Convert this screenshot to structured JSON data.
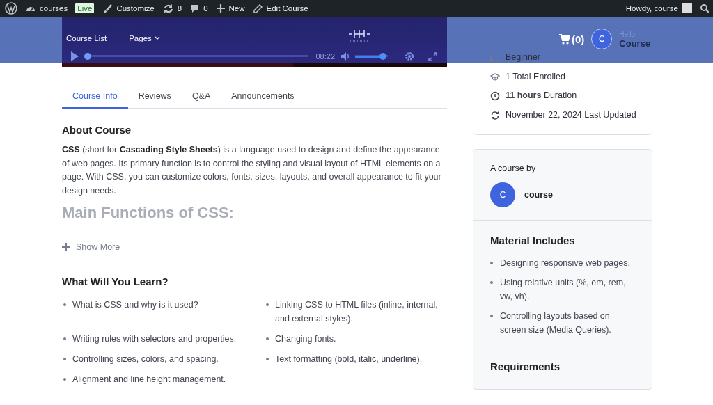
{
  "admin_bar": {
    "items": [
      {
        "kind": "wp-logo"
      },
      {
        "kind": "site",
        "label": "courses",
        "badge": "Live"
      },
      {
        "kind": "customize",
        "label": "Customize"
      },
      {
        "kind": "updates",
        "label": "8"
      },
      {
        "kind": "comments",
        "label": "0"
      },
      {
        "kind": "new",
        "label": "New"
      },
      {
        "kind": "edit",
        "label": "Edit Course"
      }
    ],
    "greeting": "Howdy, course"
  },
  "header": {
    "cart_count": "(0)",
    "avatar_letter": "C",
    "greeting": "Hello",
    "user": "Course"
  },
  "video": {
    "nav": [
      "Course List",
      "Pages"
    ],
    "time": "08:22",
    "progress": {
      "level": 0
    },
    "volume": {
      "level": 0.95
    }
  },
  "tabs": [
    {
      "label": "Course Info",
      "selected": true
    },
    {
      "label": "Reviews",
      "selected": false
    },
    {
      "label": "Q&A",
      "selected": false
    },
    {
      "label": "Announcements",
      "selected": false
    }
  ],
  "about": {
    "title": "About Course",
    "text": "**CSS** (short for **Cascading Style Sheets**) is a language used to design and define the appearance of web pages. Its primary function is to control the styling and visual layout of HTML elements on a page. With CSS, you can customize colors, fonts, sizes, layouts, and overall appearance to fit your design needs.",
    "faded_heading": "Main Functions of CSS:",
    "show_more": "Show More"
  },
  "learn": {
    "title": "What Will You Learn?",
    "items": [
      "What is CSS and why is it used?",
      "Linking CSS to HTML files (inline, internal, and external styles).",
      "Writing rules with selectors and properties.",
      "Changing fonts.",
      "Controlling sizes, colors, and spacing.",
      "Text formatting (bold, italic, underline).",
      "Alignment and line height management."
    ]
  },
  "sidebar": {
    "meta": [
      {
        "kind": "level",
        "text": "Beginner"
      },
      {
        "kind": "enrolled",
        "text": "1 Total Enrolled"
      },
      {
        "kind": "duration",
        "text": "**11 hours**  Duration"
      },
      {
        "kind": "updated",
        "text": "November 22, 2024 Last Updated"
      }
    ],
    "instructor": {
      "heading": "A course by",
      "avatar_letter": "C",
      "name": "course"
    },
    "materials": {
      "title": "Material Includes",
      "items": [
        "Designing responsive web pages.",
        "Using relative units (%, em, rem, vw, vh).",
        "Controlling layouts based on screen size (Media Queries)."
      ]
    },
    "requirements": {
      "title": "Requirements"
    }
  }
}
